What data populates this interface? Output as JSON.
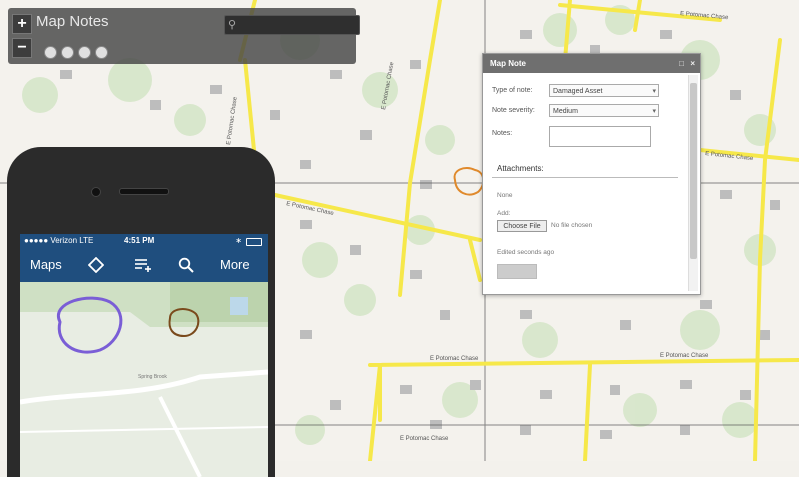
{
  "map_notes_panel": {
    "title": "Map Notes",
    "zoom_in": "+",
    "zoom_out": "−",
    "search_placeholder": ""
  },
  "map_note_dialog": {
    "title": "Map Note",
    "type_label": "Type of note:",
    "type_value": "Damaged Asset",
    "severity_label": "Note severity:",
    "severity_value": "Medium",
    "notes_label": "Notes:",
    "attachments_title": "Attachments:",
    "none_text": "None",
    "add_label": "Add:",
    "choose_file_label": "Choose File",
    "no_file_text": "No file chosen",
    "edited_text": "Edited seconds ago"
  },
  "phone": {
    "carrier": "●●●●● Verizon  LTE",
    "time": "4:51 PM",
    "nav": {
      "maps": "Maps",
      "more": "More"
    },
    "map_labels": {
      "road": "Spring Brook"
    }
  },
  "map_labels": {
    "street_1": "E Potomac Chase",
    "street_2": "E Potomac Chase",
    "street_3": "E Potomac Chase",
    "street_4": "E Potomac Chase",
    "street_5": "E Potomac Chase",
    "street_6": "E Potomac Chase",
    "street_7": "E Potomac Chase",
    "street_8": "E Potomac Chase"
  },
  "colors": {
    "road": "#f6e84a",
    "nav_blue": "#1f4e7e",
    "sketch_purple": "#7a5ed6",
    "sketch_brown": "#7a4a1c",
    "sketch_orange": "#e08a2c"
  }
}
